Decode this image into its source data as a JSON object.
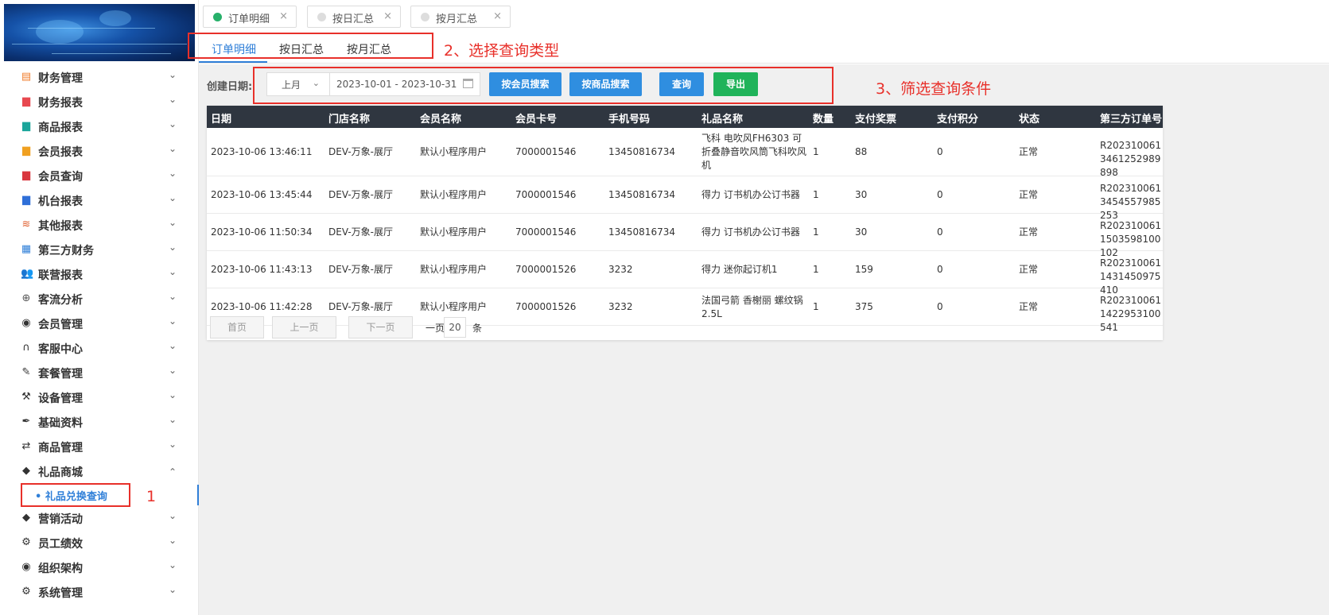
{
  "sidebar": {
    "items": [
      {
        "label": "财务管理",
        "icon": "finance-icon",
        "color": "#f07c2a",
        "glyph": "▤"
      },
      {
        "label": "财务报表",
        "icon": "report-icon",
        "color": "#e8484f",
        "glyph": "▆"
      },
      {
        "label": "商品报表",
        "icon": "goods-report-icon",
        "color": "#1aa59a",
        "glyph": "▆"
      },
      {
        "label": "会员报表",
        "icon": "member-report-icon",
        "color": "#f0a020",
        "glyph": "▆"
      },
      {
        "label": "会员查询",
        "icon": "member-query-icon",
        "color": "#d9363e",
        "glyph": "▆"
      },
      {
        "label": "机台报表",
        "icon": "machine-report-icon",
        "color": "#2f6fd8",
        "glyph": "▆"
      },
      {
        "label": "其他报表",
        "icon": "layers-icon",
        "color": "#e06030",
        "glyph": "≋"
      },
      {
        "label": "第三方财务",
        "icon": "calculator-icon",
        "color": "#2f7fd8",
        "glyph": "▦"
      },
      {
        "label": "联营报表",
        "icon": "users-icon",
        "color": "#555555",
        "glyph": "👥"
      },
      {
        "label": "客流分析",
        "icon": "target-icon",
        "color": "#555555",
        "glyph": "⊕"
      },
      {
        "label": "会员管理",
        "icon": "user-circle-icon",
        "color": "#333333",
        "glyph": "◉"
      },
      {
        "label": "客服中心",
        "icon": "headset-icon",
        "color": "#333333",
        "glyph": "∩"
      },
      {
        "label": "套餐管理",
        "icon": "edit-icon",
        "color": "#333333",
        "glyph": "✎"
      },
      {
        "label": "设备管理",
        "icon": "wrench-icon",
        "color": "#333333",
        "glyph": "⚒"
      },
      {
        "label": "基础资料",
        "icon": "pen-icon",
        "color": "#333333",
        "glyph": "✒"
      },
      {
        "label": "商品管理",
        "icon": "exchange-icon",
        "color": "#333333",
        "glyph": "⇄"
      },
      {
        "label": "礼品商城",
        "icon": "tag-icon",
        "color": "#333333",
        "glyph": "◆"
      }
    ],
    "items_after": [
      {
        "label": "营销活动",
        "icon": "tag-icon",
        "color": "#333333",
        "glyph": "◆"
      },
      {
        "label": "员工绩效",
        "icon": "gear-icon",
        "color": "#333333",
        "glyph": "⚙"
      },
      {
        "label": "组织架构",
        "icon": "radio-icon",
        "color": "#333333",
        "glyph": "◉"
      },
      {
        "label": "系统管理",
        "icon": "gear-icon",
        "color": "#333333",
        "glyph": "⚙"
      }
    ],
    "expanded_label": "礼品商城",
    "submenu_label": "• 礼品兑换查询",
    "chevron_down": "⌄",
    "chevron_up": "⌃"
  },
  "page_tabs": [
    {
      "label": "订单明细",
      "close": "×",
      "active": true
    },
    {
      "label": "按日汇总",
      "close": "×",
      "active": false
    },
    {
      "label": "按月汇总",
      "close": "×",
      "active": false
    }
  ],
  "sub_tabs": [
    "订单明细",
    "按日汇总",
    "按月汇总"
  ],
  "filter": {
    "label": "创建日期:",
    "period": "上月",
    "period_chevron": "⌄",
    "date_range": "2023-10-01 - 2023-10-31",
    "buttons": {
      "by_member": "按会员搜索",
      "by_goods": "按商品搜索",
      "query": "查询",
      "export": "导出"
    }
  },
  "table": {
    "columns": [
      "日期",
      "门店名称",
      "会员名称",
      "会员卡号",
      "手机号码",
      "礼品名称",
      "数量",
      "支付奖票",
      "支付积分",
      "状态",
      "第三方订单号"
    ],
    "rows": [
      [
        "2023-10-06 13:46:11",
        "DEV-万象-展厅",
        "默认小程序用户",
        "7000001546",
        "13450816734",
        "飞科 电吹风FH6303 可折叠静音吹风筒飞科吹风机",
        "1",
        "88",
        "0",
        "正常",
        "R2023100613461252989898"
      ],
      [
        "2023-10-06 13:45:44",
        "DEV-万象-展厅",
        "默认小程序用户",
        "7000001546",
        "13450816734",
        "得力 订书机办公订书器",
        "1",
        "30",
        "0",
        "正常",
        "R2023100613454557985253"
      ],
      [
        "2023-10-06 11:50:34",
        "DEV-万象-展厅",
        "默认小程序用户",
        "7000001546",
        "13450816734",
        "得力 订书机办公订书器",
        "1",
        "30",
        "0",
        "正常",
        "R2023100611503598100102"
      ],
      [
        "2023-10-06 11:43:13",
        "DEV-万象-展厅",
        "默认小程序用户",
        "7000001526",
        "3232",
        "得力 迷你起订机1",
        "1",
        "159",
        "0",
        "正常",
        "R2023100611431450975410"
      ],
      [
        "2023-10-06 11:42:28",
        "DEV-万象-展厅",
        "默认小程序用户",
        "7000001526",
        "3232",
        "法国弓箭 香榭丽 螺纹锅2.5L",
        "1",
        "375",
        "0",
        "正常",
        "R2023100611422953100541"
      ]
    ]
  },
  "pagination": {
    "first": "首页",
    "prev": "上一页",
    "next": "下一页",
    "per_page_label": "一页",
    "per_page_value": "20",
    "per_page_unit": "条"
  },
  "annotations": {
    "one": "1",
    "two": "2、选择查询类型",
    "three": "3、筛选查询条件"
  },
  "colors": {
    "accent": "#2f7fd8",
    "annotation": "#e8302a",
    "export": "#20b35a",
    "active_tab_dot": "#27b06a",
    "table_header": "#2f3640"
  }
}
